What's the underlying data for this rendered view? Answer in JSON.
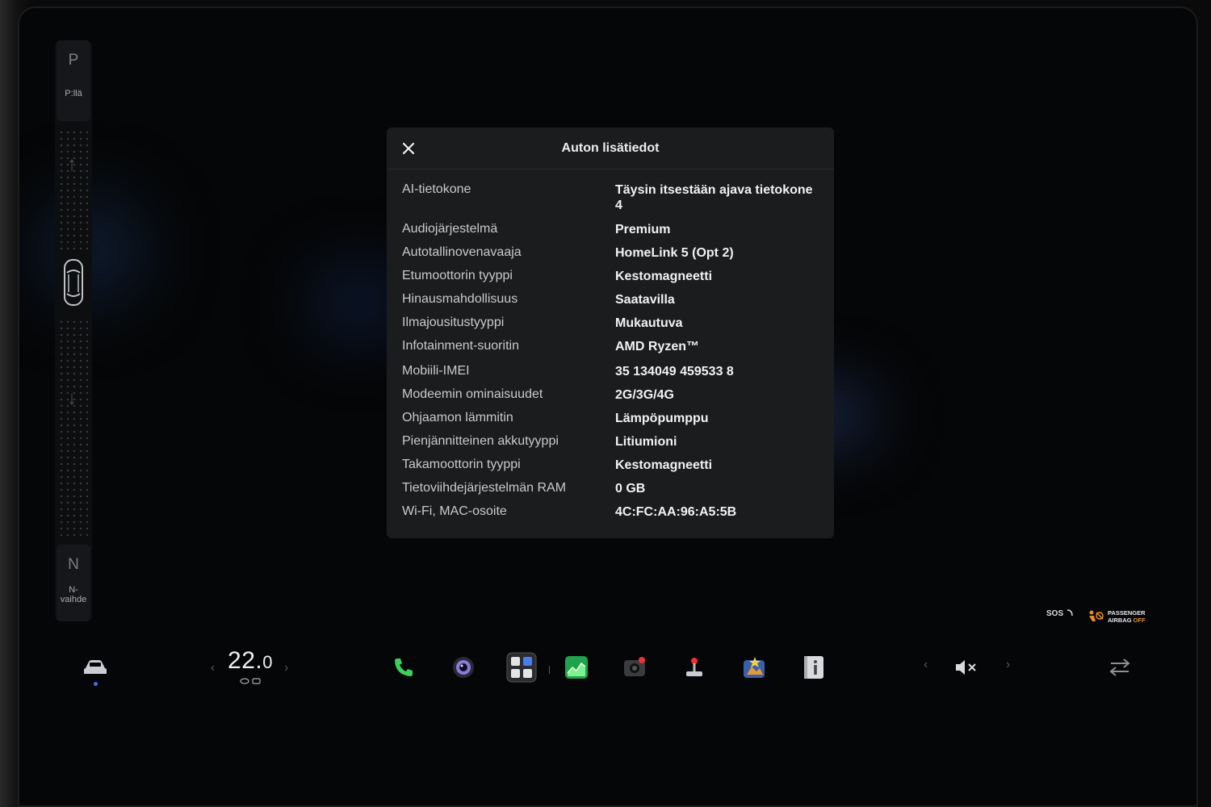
{
  "gear": {
    "park_letter": "P",
    "park_label": "P:llä",
    "neutral_letter": "N",
    "neutral_label": "N-vaihde"
  },
  "modal": {
    "title": "Auton lisätiedot",
    "rows": [
      {
        "label": "AI-tietokone",
        "value": "Täysin itsestään ajava tietokone 4"
      },
      {
        "label": "Audiojärjestelmä",
        "value": "Premium"
      },
      {
        "label": "Autotallinovenavaaja",
        "value": "HomeLink 5 (Opt 2)"
      },
      {
        "label": "Etumoottorin tyyppi",
        "value": "Kestomagneetti"
      },
      {
        "label": "Hinausmahdollisuus",
        "value": "Saatavilla"
      },
      {
        "label": "Ilmajousitustyyppi",
        "value": "Mukautuva"
      },
      {
        "label": "Infotainment-suoritin",
        "value": "AMD Ryzen™"
      },
      {
        "label": "Mobiili-IMEI",
        "value": "35 134049 459533 8"
      },
      {
        "label": "Modeemin ominaisuudet",
        "value": "2G/3G/4G"
      },
      {
        "label": "Ohjaamon lämmitin",
        "value": "Lämpöpumppu"
      },
      {
        "label": "Pienjännitteinen akkutyyppi",
        "value": "Litiumioni"
      },
      {
        "label": "Takamoottorin tyyppi",
        "value": "Kestomagneetti"
      },
      {
        "label": "Tietoviihdejärjestelmän RAM",
        "value": "0 GB"
      },
      {
        "label": "Wi-Fi, MAC-osoite",
        "value": "4C:FC:AA:96:A5:5B"
      }
    ]
  },
  "status": {
    "sos": "SOS",
    "airbag_line1": "PASSENGER",
    "airbag_line2a": "AIRBAG ",
    "airbag_line2b": "OFF"
  },
  "dock": {
    "temp_int": "22.",
    "temp_dec": "0",
    "left_chevron": "‹",
    "right_chevron": "›"
  },
  "colors": {
    "accent": "#3c6df0",
    "phone_green": "#3ccf5a",
    "airbag_orange": "#e88b2d"
  }
}
